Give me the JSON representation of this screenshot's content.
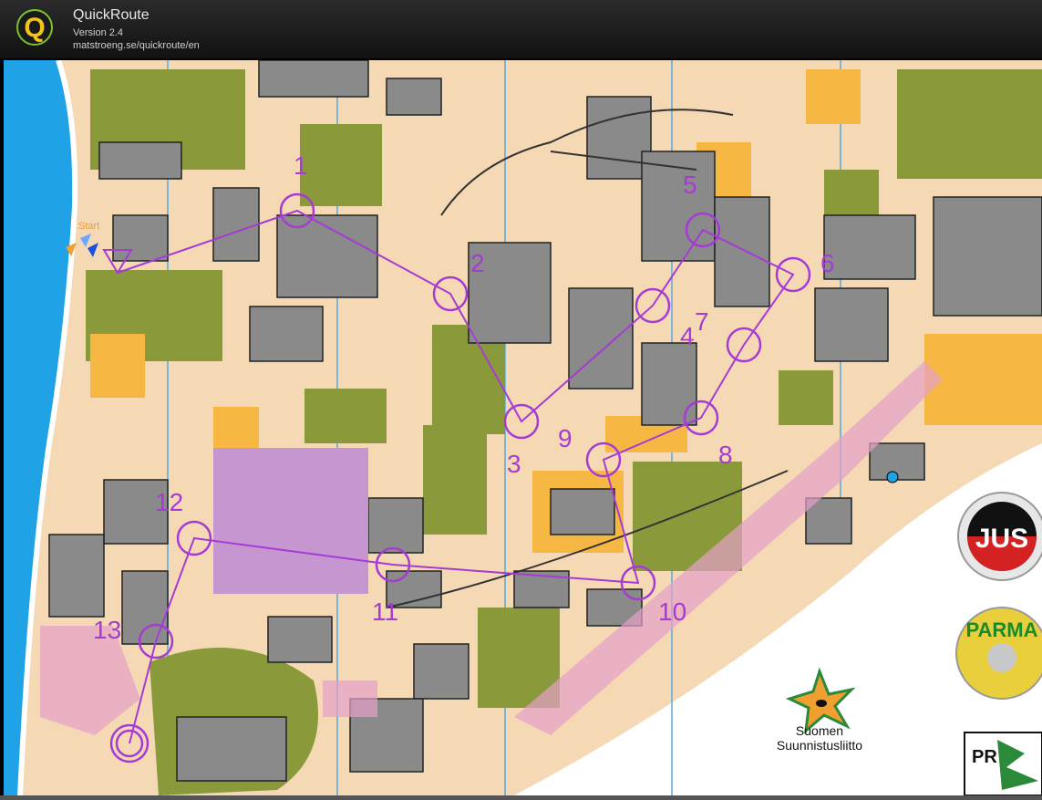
{
  "app": {
    "title": "QuickRoute",
    "version": "Version 2.4",
    "url": "matstroeng.se/quickroute/en"
  },
  "map": {
    "start_label": "Start",
    "controls": [
      "1",
      "2",
      "3",
      "4",
      "5",
      "6",
      "7",
      "8",
      "9",
      "10",
      "11",
      "12",
      "13"
    ],
    "sponsor_text_line1": "Suomen",
    "sponsor_text_line2": "Suunnistusliitto",
    "club_logo_text": "JUS",
    "parma_text": "PARMA"
  },
  "colors": {
    "course": "#a63bd4",
    "water": "#1fa3e6",
    "building": "#8a8a8a",
    "green": "#8a9a3a",
    "open": "#f5d9b5",
    "yellow": "#f7b843"
  }
}
